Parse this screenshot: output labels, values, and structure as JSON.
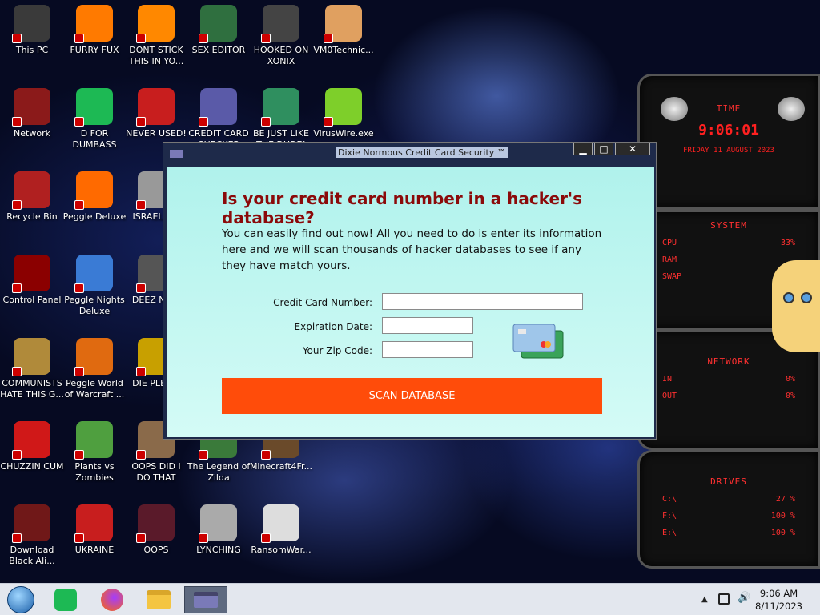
{
  "desktop_icons": [
    {
      "label": "This PC",
      "icon": "computer-icon",
      "color": "#3a3a3a"
    },
    {
      "label": "FURRY FUX",
      "icon": "firefox-icon",
      "color": "#ff7a00"
    },
    {
      "label": "DONT STICK THIS IN YO...",
      "icon": "vlc-cone-icon",
      "color": "#ff8800"
    },
    {
      "label": "SEX EDITOR",
      "icon": "hex-editor-icon",
      "color": "#2f6f3f"
    },
    {
      "label": "HOOKED ON XONIX",
      "icon": "xonix-icon",
      "color": "#444444"
    },
    {
      "label": "VM0Technic...",
      "icon": "doctor-icon",
      "color": "#e0a060"
    },
    {
      "label": "Network",
      "icon": "alien-network-icon",
      "color": "#8b1a1a"
    },
    {
      "label": "D FOR DUMBASS",
      "icon": "spotify-icon",
      "color": "#1db954"
    },
    {
      "label": "NEVER USED!",
      "icon": "devcpp-icon",
      "color": "#c81e1e"
    },
    {
      "label": "CREDIT CARD CHECKER",
      "icon": "credit-card-icon",
      "color": "#5a5aa8"
    },
    {
      "label": "BE JUST LIKE THE DUDE!",
      "icon": "elf-icon",
      "color": "#2f8f5f"
    },
    {
      "label": "VirusWire.exe",
      "icon": "limewire-icon",
      "color": "#7ecf2a"
    },
    {
      "label": "Recycle Bin",
      "icon": "recycle-bin-icon",
      "color": "#b02020"
    },
    {
      "label": "Peggle Deluxe",
      "icon": "peggle-icon",
      "color": "#ff6a00"
    },
    {
      "label": "ISRAEL S...",
      "icon": "faucet-icon",
      "color": "#999999"
    },
    {
      "label": "Control Panel",
      "icon": "control-panel-icon",
      "color": "#8b0000"
    },
    {
      "label": "Peggle Nights Deluxe",
      "icon": "peggle-nights-icon",
      "color": "#3a7bd5"
    },
    {
      "label": "DEEZ NU...",
      "icon": "deez-icon",
      "color": "#555555"
    },
    {
      "label": "COMMUNISTS HATE THIS G...",
      "icon": "money-bag-icon",
      "color": "#b08a3a"
    },
    {
      "label": "Peggle World of Warcraft ...",
      "icon": "peggle-wow-icon",
      "color": "#e06a10"
    },
    {
      "label": "DIE PLEA...",
      "icon": "die-icon",
      "color": "#c8a000"
    },
    {
      "label": "CHUZZIN CUM",
      "icon": "chuzzle-icon",
      "color": "#d01818"
    },
    {
      "label": "Plants vs Zombies",
      "icon": "plant-icon",
      "color": "#4f9f3f"
    },
    {
      "label": "OOPS DID I DO THAT",
      "icon": "portrait-icon",
      "color": "#8a6a4a"
    },
    {
      "label": "The Legend of Zilda",
      "icon": "zelda-icon",
      "color": "#3a7a3a"
    },
    {
      "label": "Minecraft4Fr...",
      "icon": "minecraft-icon",
      "color": "#6a4a2a"
    },
    {
      "label": "Download Black Ali...",
      "icon": "alien-icon",
      "color": "#701818"
    },
    {
      "label": "UKRAINE",
      "icon": "radiation-icon",
      "color": "#c81e1e"
    },
    {
      "label": "OOPS",
      "icon": "flag-icon",
      "color": "#5a1a2a"
    },
    {
      "label": "LYNCHING",
      "icon": "noose-icon",
      "color": "#aaaaaa"
    },
    {
      "label": "RansomWar...",
      "icon": "skull-icon",
      "color": "#dddddd"
    }
  ],
  "widget": {
    "time_title": "TIME",
    "time_value": "9:06:01",
    "date_value": "FRIDAY 11 AUGUST 2023",
    "system_title": "SYSTEM",
    "system_rows": [
      {
        "label": "CPU",
        "value": "33%"
      },
      {
        "label": "RAM",
        "value": ""
      },
      {
        "label": "SWAP",
        "value": ""
      }
    ],
    "network_title": "NETWORK",
    "network_rows": [
      {
        "label": "IN",
        "value": "0%"
      },
      {
        "label": "OUT",
        "value": "0%"
      }
    ],
    "drives_title": "DRIVES",
    "drive_rows": [
      {
        "label": "C:\\",
        "value": "27 %"
      },
      {
        "label": "F:\\",
        "value": "100 %"
      },
      {
        "label": "E:\\",
        "value": "100 %"
      }
    ]
  },
  "window": {
    "title": "Dixie Normous Credit Card Security ™",
    "minimize": "▁",
    "maximize": "□",
    "close": "✕",
    "heading": "Is your credit card number in a hacker's database?",
    "description": "You can easily find out now! All you need to do is enter its information here and we will scan thousands of hacker databases to see if any they have match yours.",
    "card_number_label": "Credit Card Number:",
    "card_number_value": "",
    "expiration_label": "Expiration Date:",
    "expiration_value": "",
    "zip_label": "Your Zip Code:",
    "zip_value": "",
    "scan_button": "SCAN DATABASE"
  },
  "taskbar": {
    "time": "9:06 AM",
    "date": "8/11/2023",
    "apps": [
      "start-orb-icon",
      "spotify-icon",
      "firefox-icon",
      "file-explorer-icon",
      "credit-card-app-icon"
    ]
  },
  "colors": {
    "heading": "#8b0a0a",
    "button": "#ff4c0a",
    "content_bg": "#c8f7f2",
    "widget_red": "#ff3030"
  }
}
